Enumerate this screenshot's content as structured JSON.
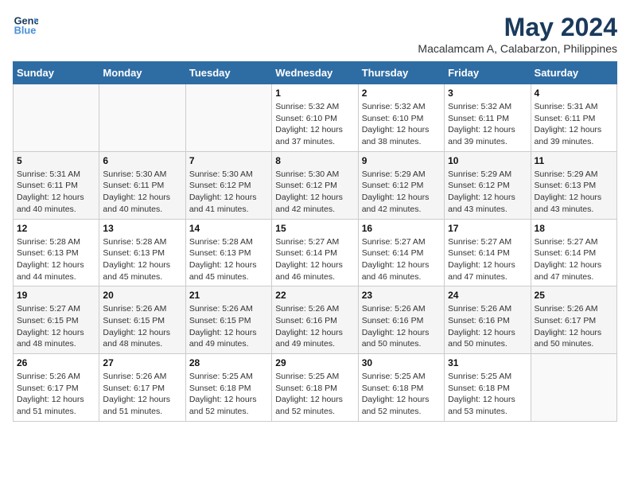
{
  "logo": {
    "line1": "General",
    "line2": "Blue"
  },
  "title": "May 2024",
  "location": "Macalamcam A, Calabarzon, Philippines",
  "days_header": [
    "Sunday",
    "Monday",
    "Tuesday",
    "Wednesday",
    "Thursday",
    "Friday",
    "Saturday"
  ],
  "weeks": [
    [
      {
        "num": "",
        "sunrise": "",
        "sunset": "",
        "daylight": ""
      },
      {
        "num": "",
        "sunrise": "",
        "sunset": "",
        "daylight": ""
      },
      {
        "num": "",
        "sunrise": "",
        "sunset": "",
        "daylight": ""
      },
      {
        "num": "1",
        "sunrise": "Sunrise: 5:32 AM",
        "sunset": "Sunset: 6:10 PM",
        "daylight": "Daylight: 12 hours and 37 minutes."
      },
      {
        "num": "2",
        "sunrise": "Sunrise: 5:32 AM",
        "sunset": "Sunset: 6:10 PM",
        "daylight": "Daylight: 12 hours and 38 minutes."
      },
      {
        "num": "3",
        "sunrise": "Sunrise: 5:32 AM",
        "sunset": "Sunset: 6:11 PM",
        "daylight": "Daylight: 12 hours and 39 minutes."
      },
      {
        "num": "4",
        "sunrise": "Sunrise: 5:31 AM",
        "sunset": "Sunset: 6:11 PM",
        "daylight": "Daylight: 12 hours and 39 minutes."
      }
    ],
    [
      {
        "num": "5",
        "sunrise": "Sunrise: 5:31 AM",
        "sunset": "Sunset: 6:11 PM",
        "daylight": "Daylight: 12 hours and 40 minutes."
      },
      {
        "num": "6",
        "sunrise": "Sunrise: 5:30 AM",
        "sunset": "Sunset: 6:11 PM",
        "daylight": "Daylight: 12 hours and 40 minutes."
      },
      {
        "num": "7",
        "sunrise": "Sunrise: 5:30 AM",
        "sunset": "Sunset: 6:12 PM",
        "daylight": "Daylight: 12 hours and 41 minutes."
      },
      {
        "num": "8",
        "sunrise": "Sunrise: 5:30 AM",
        "sunset": "Sunset: 6:12 PM",
        "daylight": "Daylight: 12 hours and 42 minutes."
      },
      {
        "num": "9",
        "sunrise": "Sunrise: 5:29 AM",
        "sunset": "Sunset: 6:12 PM",
        "daylight": "Daylight: 12 hours and 42 minutes."
      },
      {
        "num": "10",
        "sunrise": "Sunrise: 5:29 AM",
        "sunset": "Sunset: 6:12 PM",
        "daylight": "Daylight: 12 hours and 43 minutes."
      },
      {
        "num": "11",
        "sunrise": "Sunrise: 5:29 AM",
        "sunset": "Sunset: 6:13 PM",
        "daylight": "Daylight: 12 hours and 43 minutes."
      }
    ],
    [
      {
        "num": "12",
        "sunrise": "Sunrise: 5:28 AM",
        "sunset": "Sunset: 6:13 PM",
        "daylight": "Daylight: 12 hours and 44 minutes."
      },
      {
        "num": "13",
        "sunrise": "Sunrise: 5:28 AM",
        "sunset": "Sunset: 6:13 PM",
        "daylight": "Daylight: 12 hours and 45 minutes."
      },
      {
        "num": "14",
        "sunrise": "Sunrise: 5:28 AM",
        "sunset": "Sunset: 6:13 PM",
        "daylight": "Daylight: 12 hours and 45 minutes."
      },
      {
        "num": "15",
        "sunrise": "Sunrise: 5:27 AM",
        "sunset": "Sunset: 6:14 PM",
        "daylight": "Daylight: 12 hours and 46 minutes."
      },
      {
        "num": "16",
        "sunrise": "Sunrise: 5:27 AM",
        "sunset": "Sunset: 6:14 PM",
        "daylight": "Daylight: 12 hours and 46 minutes."
      },
      {
        "num": "17",
        "sunrise": "Sunrise: 5:27 AM",
        "sunset": "Sunset: 6:14 PM",
        "daylight": "Daylight: 12 hours and 47 minutes."
      },
      {
        "num": "18",
        "sunrise": "Sunrise: 5:27 AM",
        "sunset": "Sunset: 6:14 PM",
        "daylight": "Daylight: 12 hours and 47 minutes."
      }
    ],
    [
      {
        "num": "19",
        "sunrise": "Sunrise: 5:27 AM",
        "sunset": "Sunset: 6:15 PM",
        "daylight": "Daylight: 12 hours and 48 minutes."
      },
      {
        "num": "20",
        "sunrise": "Sunrise: 5:26 AM",
        "sunset": "Sunset: 6:15 PM",
        "daylight": "Daylight: 12 hours and 48 minutes."
      },
      {
        "num": "21",
        "sunrise": "Sunrise: 5:26 AM",
        "sunset": "Sunset: 6:15 PM",
        "daylight": "Daylight: 12 hours and 49 minutes."
      },
      {
        "num": "22",
        "sunrise": "Sunrise: 5:26 AM",
        "sunset": "Sunset: 6:16 PM",
        "daylight": "Daylight: 12 hours and 49 minutes."
      },
      {
        "num": "23",
        "sunrise": "Sunrise: 5:26 AM",
        "sunset": "Sunset: 6:16 PM",
        "daylight": "Daylight: 12 hours and 50 minutes."
      },
      {
        "num": "24",
        "sunrise": "Sunrise: 5:26 AM",
        "sunset": "Sunset: 6:16 PM",
        "daylight": "Daylight: 12 hours and 50 minutes."
      },
      {
        "num": "25",
        "sunrise": "Sunrise: 5:26 AM",
        "sunset": "Sunset: 6:17 PM",
        "daylight": "Daylight: 12 hours and 50 minutes."
      }
    ],
    [
      {
        "num": "26",
        "sunrise": "Sunrise: 5:26 AM",
        "sunset": "Sunset: 6:17 PM",
        "daylight": "Daylight: 12 hours and 51 minutes."
      },
      {
        "num": "27",
        "sunrise": "Sunrise: 5:26 AM",
        "sunset": "Sunset: 6:17 PM",
        "daylight": "Daylight: 12 hours and 51 minutes."
      },
      {
        "num": "28",
        "sunrise": "Sunrise: 5:25 AM",
        "sunset": "Sunset: 6:18 PM",
        "daylight": "Daylight: 12 hours and 52 minutes."
      },
      {
        "num": "29",
        "sunrise": "Sunrise: 5:25 AM",
        "sunset": "Sunset: 6:18 PM",
        "daylight": "Daylight: 12 hours and 52 minutes."
      },
      {
        "num": "30",
        "sunrise": "Sunrise: 5:25 AM",
        "sunset": "Sunset: 6:18 PM",
        "daylight": "Daylight: 12 hours and 52 minutes."
      },
      {
        "num": "31",
        "sunrise": "Sunrise: 5:25 AM",
        "sunset": "Sunset: 6:18 PM",
        "daylight": "Daylight: 12 hours and 53 minutes."
      },
      {
        "num": "",
        "sunrise": "",
        "sunset": "",
        "daylight": ""
      }
    ]
  ]
}
